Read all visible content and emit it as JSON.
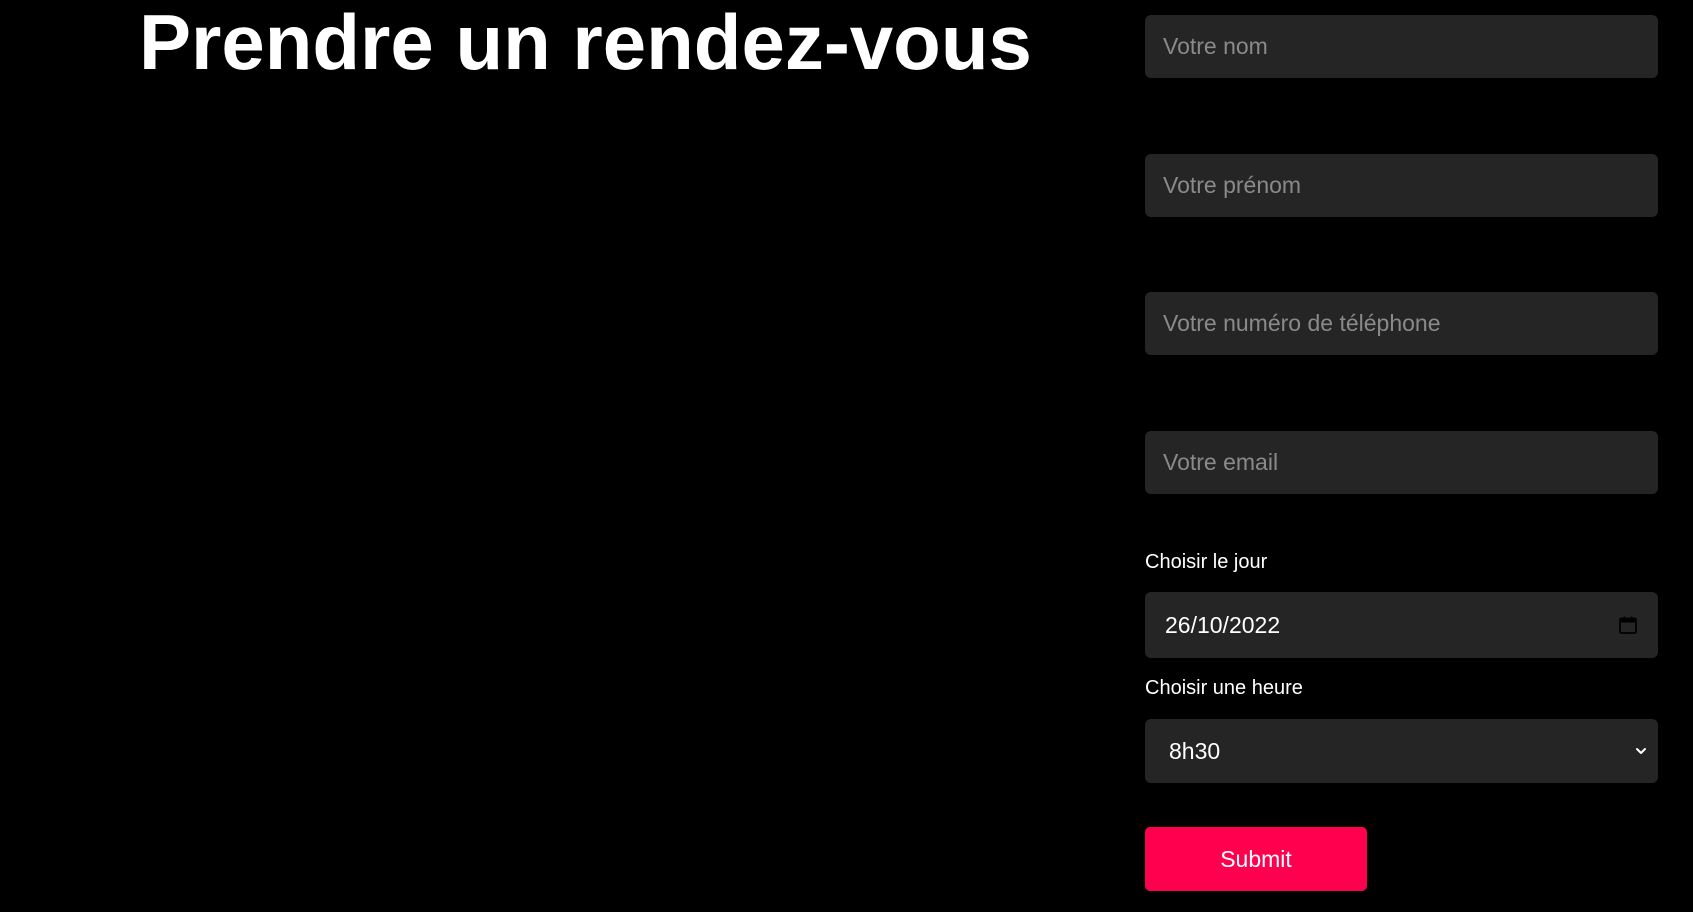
{
  "page": {
    "title": "Prendre un rendez-vous"
  },
  "form": {
    "name_placeholder": "Votre nom",
    "firstname_placeholder": "Votre prénom",
    "phone_placeholder": "Votre numéro de téléphone",
    "email_placeholder": "Votre email",
    "day_label": "Choisir le jour",
    "day_value": "26/10/2022",
    "hour_label": "Choisir une heure",
    "hour_value": "8h30",
    "submit_label": "Submit"
  },
  "colors": {
    "background": "#000000",
    "field_background": "#252525",
    "placeholder": "#8a8a8a",
    "accent": "#ff004f",
    "text": "#ffffff"
  },
  "icons": {
    "date_picker": "calendar-icon",
    "select_arrow": "chevron-down-icon"
  }
}
